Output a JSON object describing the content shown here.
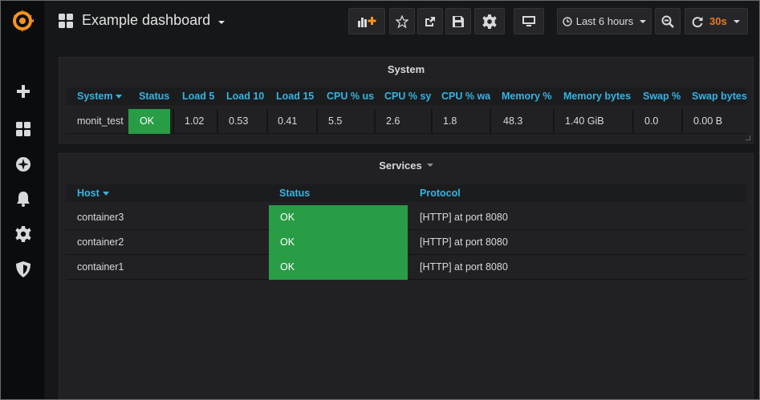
{
  "app": {
    "dashboard_title": "Example dashboard",
    "logo_icon": "grafana-logo-icon",
    "brand_color": "#f7941e"
  },
  "sidemenu": {
    "items": [
      {
        "name": "create",
        "icon": "plus-icon"
      },
      {
        "name": "dashboards",
        "icon": "grid-icon"
      },
      {
        "name": "explore",
        "icon": "compass-icon"
      },
      {
        "name": "alerting",
        "icon": "bell-icon"
      },
      {
        "name": "configuration",
        "icon": "gear-icon"
      },
      {
        "name": "server-admin",
        "icon": "shield-icon"
      }
    ]
  },
  "toolbar": {
    "add_panel_icon": "add-panel-icon",
    "star_icon": "star-icon",
    "share_icon": "share-icon",
    "save_icon": "save-icon",
    "settings_icon": "gear-icon",
    "tv_mode_icon": "monitor-icon",
    "time_range": "Last 6 hours",
    "zoom_out_icon": "zoom-out-icon",
    "refresh_icon": "refresh-icon",
    "refresh_interval": "30s",
    "refresh_interval_color": "#eb7b18"
  },
  "system_panel": {
    "title": "System",
    "columns": [
      "System",
      "Status",
      "Load 5",
      "Load 10",
      "Load 15",
      "CPU % us",
      "CPU % sy",
      "CPU % wa",
      "Memory %",
      "Memory bytes",
      "Swap %",
      "Swap bytes"
    ],
    "rows": [
      [
        "monit_test",
        "OK",
        "1.02",
        "0.53",
        "0.41",
        "5.5",
        "2.6",
        "1.8",
        "48.3",
        "1.40 GiB",
        "0.0",
        "0.00 B"
      ]
    ]
  },
  "services_panel": {
    "title": "Services",
    "columns": [
      "Host",
      "Status",
      "Protocol"
    ],
    "rows": [
      [
        "container3",
        "OK",
        "[HTTP] at port 8080"
      ],
      [
        "container2",
        "OK",
        "[HTTP] at port 8080"
      ],
      [
        "container1",
        "OK",
        "[HTTP] at port 8080"
      ]
    ]
  },
  "colors": {
    "status_ok": "#299c46",
    "header_link": "#33b5e5"
  }
}
